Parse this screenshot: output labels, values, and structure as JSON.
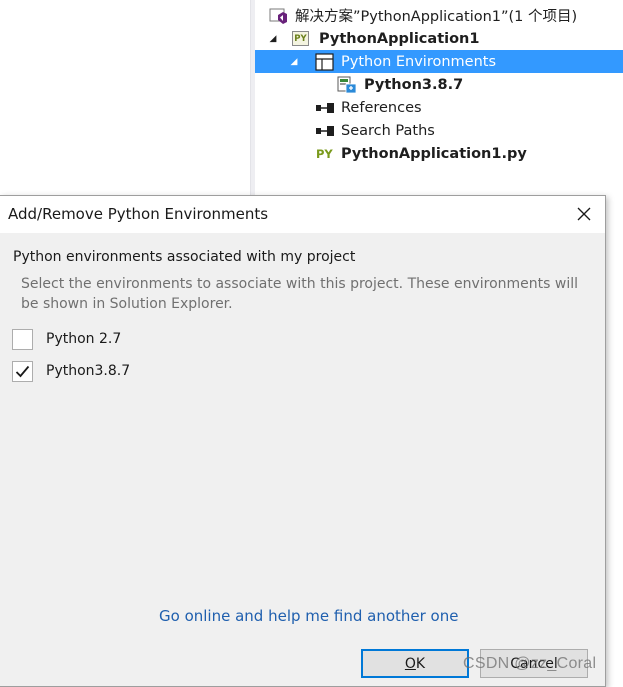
{
  "solution_explorer": {
    "solution_label": "解决方案”PythonApplication1”(1 个项目)",
    "project": {
      "label": "PythonApplication1",
      "badge": "PY"
    },
    "python_environments": {
      "label": "Python Environments"
    },
    "environment": {
      "label": "Python3.8.7"
    },
    "references": {
      "label": "References"
    },
    "search_paths": {
      "label": "Search Paths"
    },
    "file": {
      "label": "PythonApplication1.py",
      "badge": "PY"
    },
    "expand_glyph": "◢"
  },
  "dialog": {
    "title": "Add/Remove Python Environments",
    "close_glyph": "✕",
    "section_heading": "Python environments associated with my project",
    "description": "Select the environments to associate with this project. These environments will be shown in Solution Explorer.",
    "environments": [
      {
        "label": "Python 2.7",
        "checked": false
      },
      {
        "label": "Python3.8.7",
        "checked": true
      }
    ],
    "check_glyph": "✓",
    "link_text": "Go online and help me find another one",
    "ok_label": {
      "mnemonic": "O",
      "rest": "K"
    },
    "cancel_label": "Cancel"
  },
  "watermark": "CSDN @zz_Coral",
  "colors": {
    "selection": "#3399ff",
    "link": "#1f5fae",
    "dialog_bg": "#f0f0f0",
    "default_button_border": "#0078d7"
  }
}
